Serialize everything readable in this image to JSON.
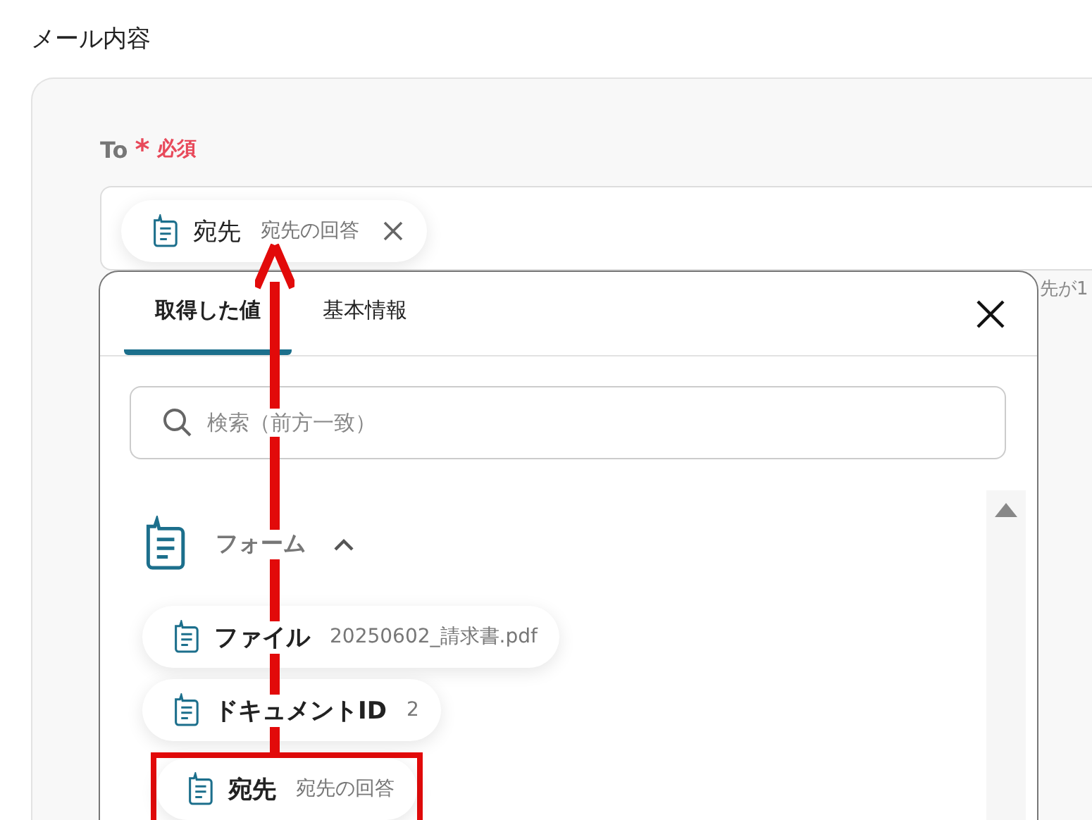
{
  "section_title": "メール内容",
  "to_field": {
    "label": "To",
    "required_mark": "*",
    "required_label": "必須",
    "chips": [
      {
        "name": "宛先",
        "value": "宛先の回答"
      }
    ]
  },
  "background_hint": "先が1",
  "picker": {
    "tabs": [
      {
        "label": "取得した値",
        "selected": true
      },
      {
        "label": "基本情報",
        "selected": false
      }
    ],
    "search": {
      "placeholder": "検索（前方一致）"
    },
    "groups": [
      {
        "title": "フォーム",
        "expanded": true,
        "items": [
          {
            "name": "ファイル",
            "value": "20250602_請求書.pdf",
            "highlighted": false
          },
          {
            "name": "ドキュメントID",
            "value": "2",
            "highlighted": false
          },
          {
            "name": "宛先",
            "value": "宛先の回答",
            "highlighted": true
          }
        ]
      }
    ]
  }
}
